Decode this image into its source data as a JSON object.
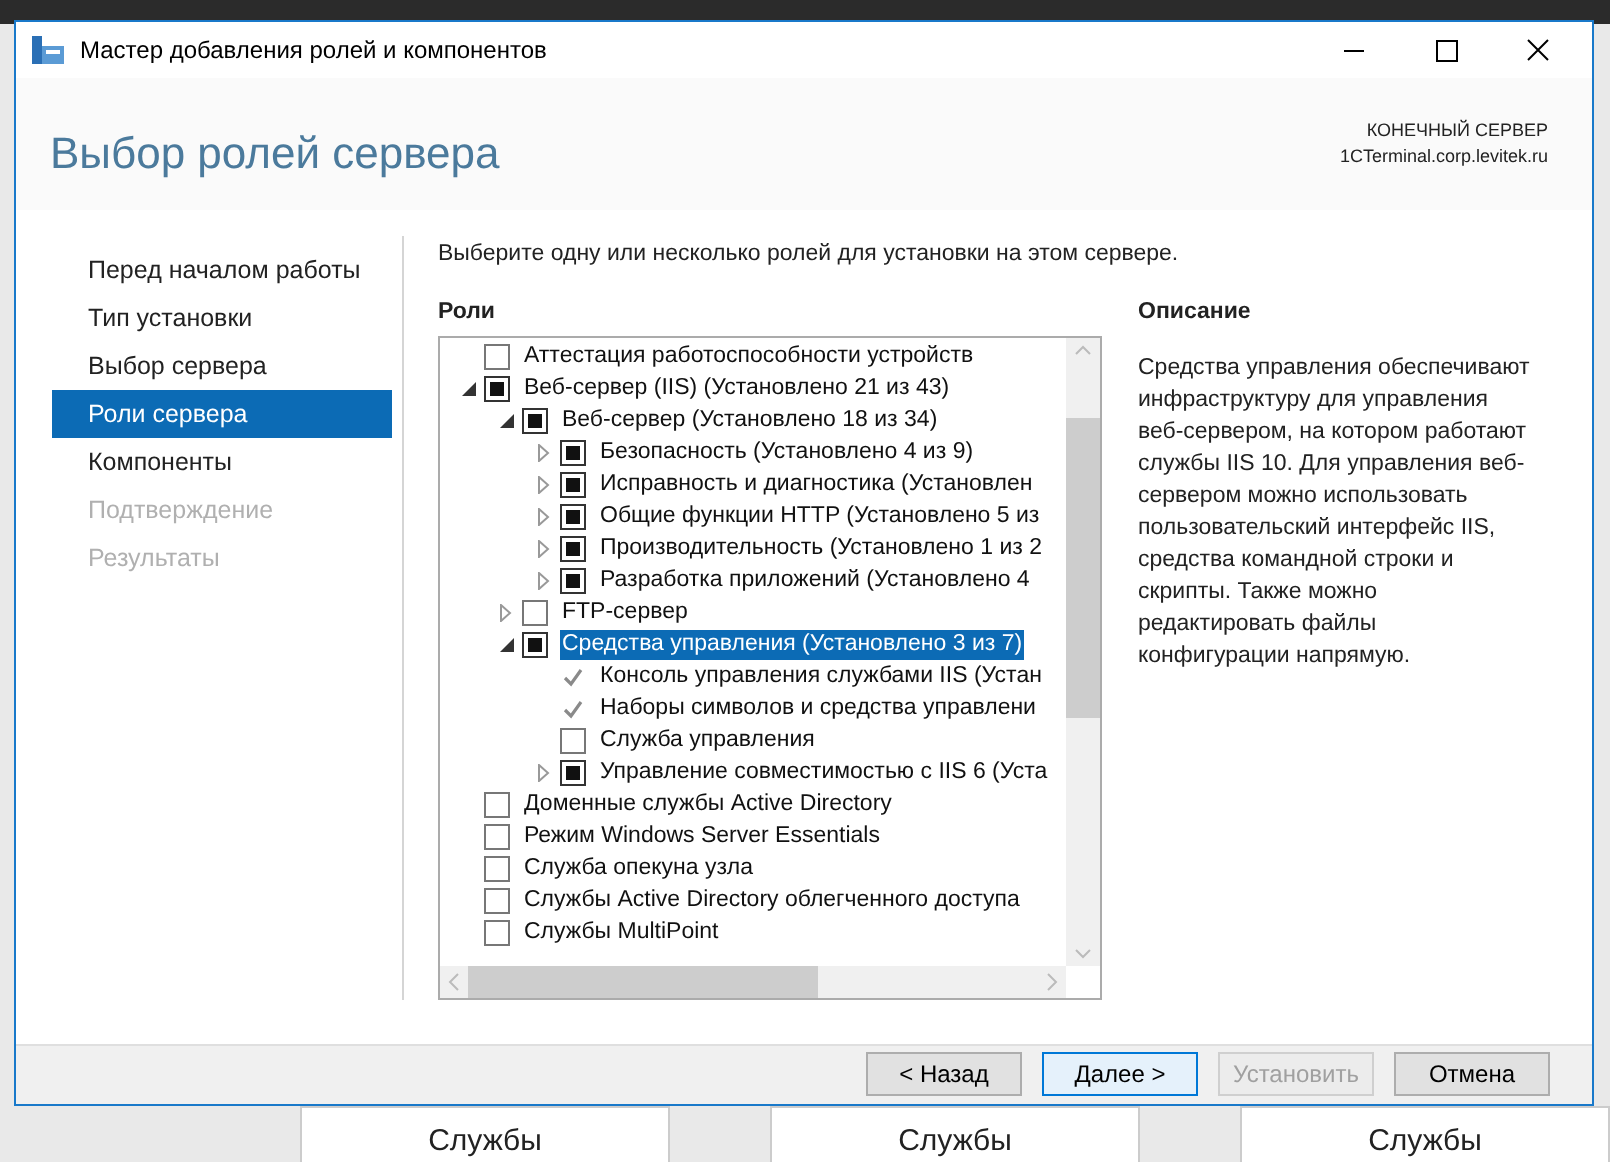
{
  "background": {
    "tiles": [
      "Службы",
      "Службы",
      "Службы"
    ]
  },
  "window": {
    "title": "Мастер добавления ролей и компонентов"
  },
  "header": {
    "title": "Выбор ролей сервера",
    "target_label": "КОНЕЧНЫЙ СЕРВЕР",
    "target_server": "1CTerminal.corp.levitek.ru"
  },
  "sidebar": {
    "items": [
      {
        "label": "Перед началом работы",
        "selected": false,
        "disabled": false
      },
      {
        "label": "Тип установки",
        "selected": false,
        "disabled": false
      },
      {
        "label": "Выбор сервера",
        "selected": false,
        "disabled": false
      },
      {
        "label": "Роли сервера",
        "selected": true,
        "disabled": false
      },
      {
        "label": "Компоненты",
        "selected": false,
        "disabled": false
      },
      {
        "label": "Подтверждение",
        "selected": false,
        "disabled": true
      },
      {
        "label": "Результаты",
        "selected": false,
        "disabled": true
      }
    ]
  },
  "instruction": "Выберите одну или несколько ролей для установки на этом сервере.",
  "roles": {
    "heading": "Роли",
    "items": [
      {
        "label": "Аттестация работоспособности устройств",
        "checked": false,
        "partial": false,
        "selected": false
      },
      {
        "label": "Веб-сервер (IIS) (Установлено 21 из 43)",
        "checked": false,
        "partial": true,
        "selected": false,
        "expanded": true,
        "children": [
          {
            "label": "Веб-сервер (Установлено 18 из 34)",
            "checked": false,
            "partial": true,
            "selected": false,
            "expanded": true,
            "children": [
              {
                "label": "Безопасность (Установлено 4 из 9)",
                "checked": false,
                "partial": true,
                "selected": false,
                "expanded": false
              },
              {
                "label": "Исправность и диагностика (Установлен",
                "checked": false,
                "partial": true,
                "selected": false,
                "expanded": false
              },
              {
                "label": "Общие функции HTTP (Установлено 5 из",
                "checked": false,
                "partial": true,
                "selected": false,
                "expanded": false
              },
              {
                "label": "Производительность (Установлено 1 из 2",
                "checked": false,
                "partial": true,
                "selected": false,
                "expanded": false
              },
              {
                "label": "Разработка приложений (Установлено 4",
                "checked": false,
                "partial": true,
                "selected": false,
                "expanded": false
              }
            ]
          },
          {
            "label": "FTP-сервер",
            "checked": false,
            "partial": false,
            "selected": false,
            "expanded": false
          },
          {
            "label": "Средства управления (Установлено 3 из 7)",
            "checked": false,
            "partial": true,
            "selected": true,
            "expanded": true,
            "children": [
              {
                "label": "Консоль управления службами IIS (Устан",
                "checked": true,
                "partial": false,
                "selected": false
              },
              {
                "label": "Наборы символов и средства управлени",
                "checked": true,
                "partial": false,
                "selected": false
              },
              {
                "label": "Служба управления",
                "checked": false,
                "partial": false,
                "selected": false
              },
              {
                "label": "Управление совместимостью с IIS 6 (Уста",
                "checked": false,
                "partial": true,
                "selected": false,
                "expanded": false
              }
            ]
          }
        ]
      },
      {
        "label": "Доменные службы Active Directory",
        "checked": false,
        "partial": false,
        "selected": false
      },
      {
        "label": "Режим Windows Server Essentials",
        "checked": false,
        "partial": false,
        "selected": false
      },
      {
        "label": "Служба опекуна узла",
        "checked": false,
        "partial": false,
        "selected": false
      },
      {
        "label": "Службы Active Directory облегченного доступа",
        "checked": false,
        "partial": false,
        "selected": false
      },
      {
        "label": "Службы MultiPoint",
        "checked": false,
        "partial": false,
        "selected": false
      }
    ]
  },
  "description": {
    "heading": "Описание",
    "text": "Средства управления обеспечивают инфраструктуру для управления веб-сервером, на котором работают службы IIS 10. Для управления веб-сервером можно использовать пользовательский интерфейс IIS, средства командной строки и скрипты. Также можно редактировать файлы конфигурации напрямую."
  },
  "buttons": [
    {
      "label": "< Назад",
      "disabled": false,
      "focused": false
    },
    {
      "label": "Далее >",
      "disabled": false,
      "focused": true
    },
    {
      "label": "Установить",
      "disabled": true,
      "focused": false
    },
    {
      "label": "Отмена",
      "disabled": false,
      "focused": false
    }
  ]
}
